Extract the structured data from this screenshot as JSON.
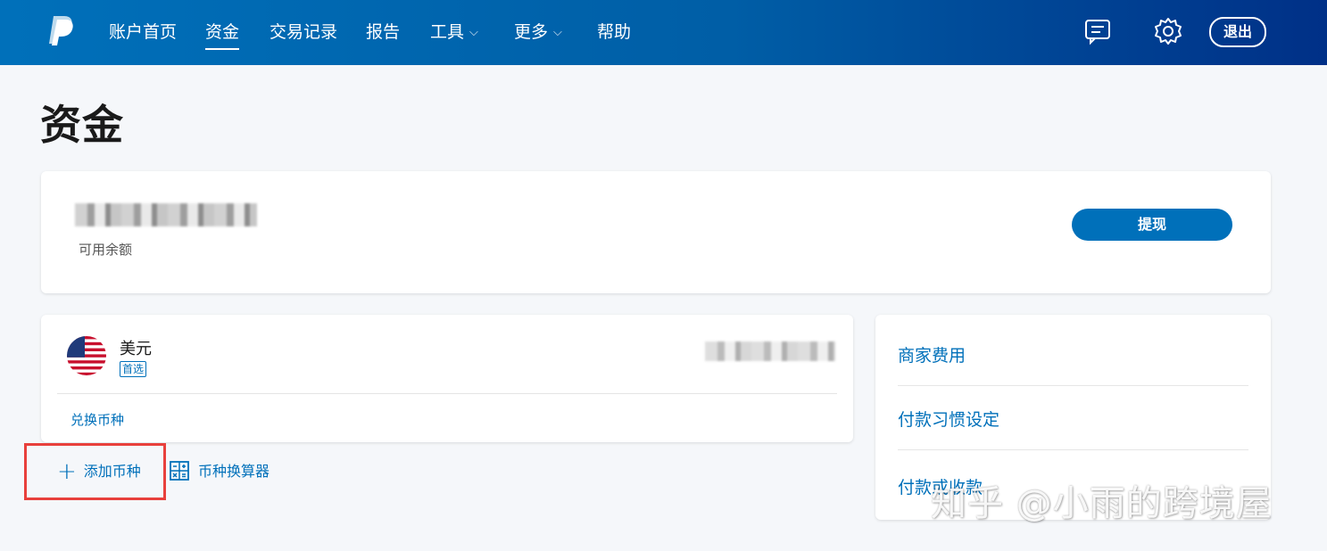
{
  "nav": {
    "items": [
      {
        "label": "账户首页",
        "active": false,
        "dropdown": false
      },
      {
        "label": "资金",
        "active": true,
        "dropdown": false
      },
      {
        "label": "交易记录",
        "active": false,
        "dropdown": false
      },
      {
        "label": "报告",
        "active": false,
        "dropdown": false
      },
      {
        "label": "工具",
        "active": false,
        "dropdown": true
      },
      {
        "label": "更多",
        "active": false,
        "dropdown": true
      },
      {
        "label": "帮助",
        "active": false,
        "dropdown": false
      }
    ],
    "chevron": "⌵",
    "logout_label": "退出",
    "icons": [
      "paypal-logo",
      "message-icon",
      "gear-icon"
    ]
  },
  "page": {
    "title": "资金"
  },
  "balance": {
    "label": "可用余额",
    "withdraw_label": "提现"
  },
  "currency": {
    "name": "美元",
    "badge": "首选",
    "flag": "us-flag-icon",
    "convert_label": "兑换币种"
  },
  "actions": {
    "add_currency_label": "添加币种",
    "calculator_label": "币种换算器"
  },
  "side_links": [
    "商家费用",
    "付款习惯设定",
    "付款或收款"
  ],
  "watermark": "知乎 @小雨的跨境屋",
  "colors": {
    "brand_blue": "#0070ba",
    "header_dark": "#003087",
    "highlight_red": "#e8403c",
    "background": "#f5f7fa"
  }
}
